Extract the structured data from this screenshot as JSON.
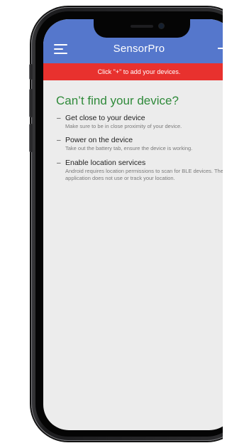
{
  "header": {
    "title": "SensorPro",
    "background": "#5577cc",
    "menu_icon": "hamburger-menu-icon",
    "add_icon": "plus-icon"
  },
  "banner": {
    "text": "Click \"+\" to add your devices.",
    "background": "#e8312e"
  },
  "help": {
    "title": "Can’t find your device?",
    "title_color": "#2f8a3a",
    "tips": [
      {
        "bullet": "–",
        "title": "Get close to your device",
        "description": "Make sure to be in close proximity of your device."
      },
      {
        "bullet": "–",
        "title": "Power on the device",
        "description": "Take out the battery tab, ensure the device is working."
      },
      {
        "bullet": "–",
        "title": "Enable location services",
        "description": "Android requires location permissions to scan for BLE devices. The application does not use or track your location."
      }
    ]
  }
}
